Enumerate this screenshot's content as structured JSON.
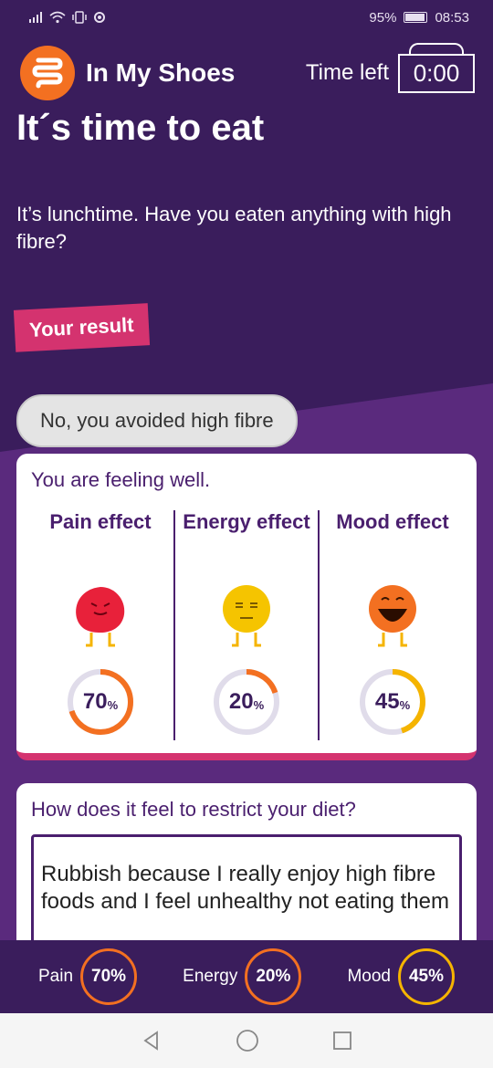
{
  "status_bar": {
    "battery": "95%",
    "time": "08:53",
    "left_icons": [
      "signal-icon",
      "wifi-icon",
      "vibrate-icon",
      "data-icon"
    ]
  },
  "header": {
    "app_name": "In My Shoes",
    "timer_label": "Time left",
    "timer_value": "0:00"
  },
  "page": {
    "title": "It´s time to eat",
    "question": "It’s lunchtime. Have you eaten anything with high fibre?",
    "result_tag": "Your result",
    "answer": "No, you avoided high fibre"
  },
  "effects": {
    "feeling": "You are feeling well.",
    "items": [
      {
        "title": "Pain effect",
        "value": "70",
        "percent": 70,
        "color": "#f37021",
        "character": "red-blob-icon"
      },
      {
        "title": "Energy effect",
        "value": "20",
        "percent": 20,
        "color": "#f37021",
        "character": "yellow-face-icon"
      },
      {
        "title": "Mood effect",
        "value": "45",
        "percent": 45,
        "color": "#f5b400",
        "character": "orange-laughing-icon"
      }
    ],
    "percent_sign": "%"
  },
  "restrict": {
    "question": "How does it feel to restrict your diet?",
    "answer": "Rubbish because I really enjoy high fibre foods and I feel unhealthy not eating them"
  },
  "bottom_stats": [
    {
      "label": "Pain",
      "value": "70%",
      "color": "#f37021"
    },
    {
      "label": "Energy",
      "value": "20%",
      "color": "#f37021"
    },
    {
      "label": "Mood",
      "value": "45%",
      "color": "#f5b400"
    }
  ],
  "colors": {
    "background": "#3a1d5c",
    "accent_pink": "#d4336f",
    "brand_orange": "#f37021",
    "ring_track": "#e0dcea"
  }
}
